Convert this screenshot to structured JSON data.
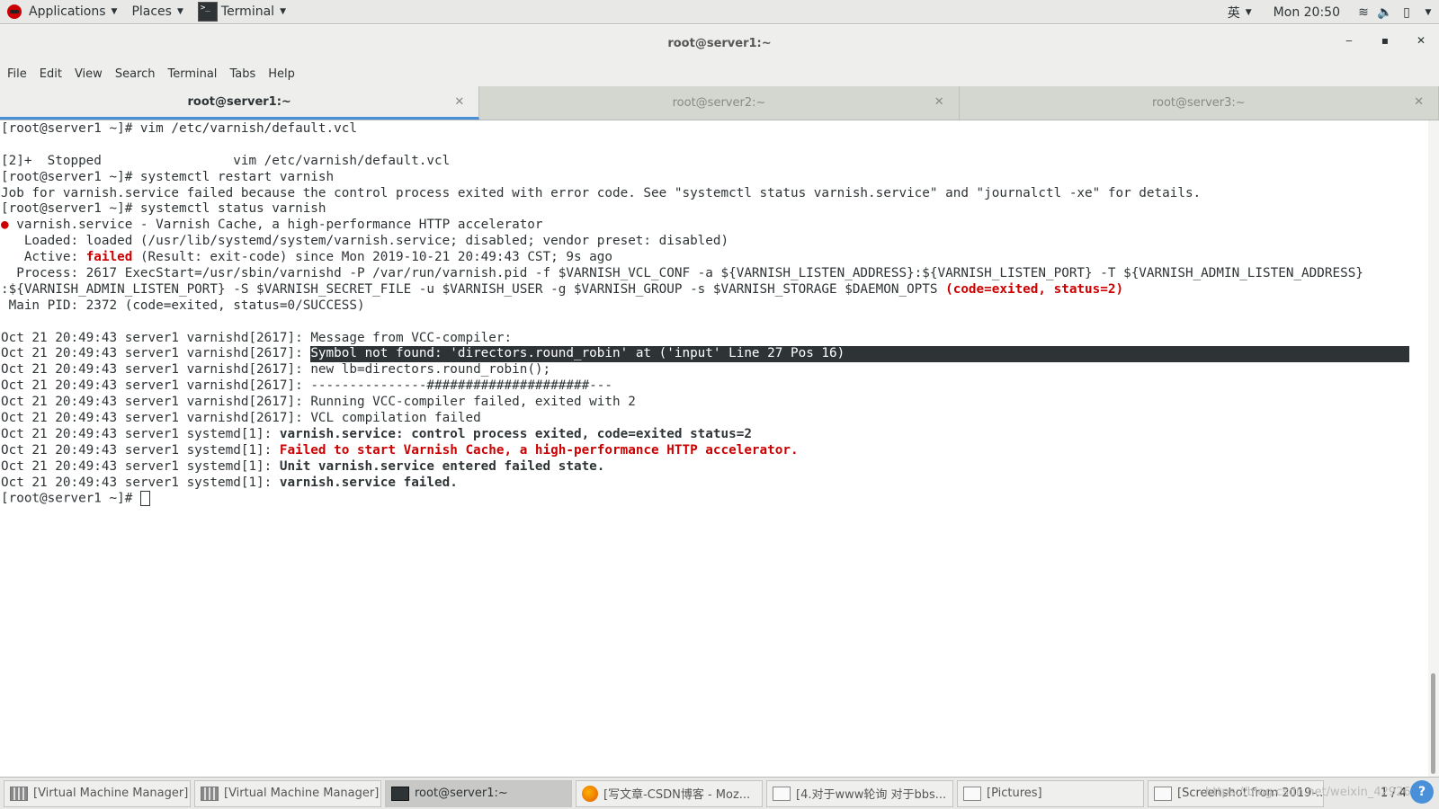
{
  "top_bar": {
    "applications_label": "Applications",
    "places_label": "Places",
    "terminal_label": "Terminal",
    "input_method": "英",
    "clock": "Mon 20:50"
  },
  "window": {
    "title": "root@server1:~",
    "minimize": "‒",
    "maximize": "▪",
    "close": "✕"
  },
  "menu": [
    "File",
    "Edit",
    "View",
    "Search",
    "Terminal",
    "Tabs",
    "Help"
  ],
  "tabs": [
    {
      "label": "root@server1:~",
      "active": true
    },
    {
      "label": "root@server2:~",
      "active": false
    },
    {
      "label": "root@server3:~",
      "active": false
    }
  ],
  "terminal": {
    "lines": [
      "[root@server1 ~]# vim /etc/varnish/default.vcl",
      "",
      "[2]+  Stopped                 vim /etc/varnish/default.vcl",
      "[root@server1 ~]# systemctl restart varnish",
      "Job for varnish.service failed because the control process exited with error code. See \"systemctl status varnish.service\" and \"journalctl -xe\" for details.",
      "[root@server1 ~]# systemctl status varnish"
    ],
    "status_dot": "●",
    "status_head": " varnish.service - Varnish Cache, a high-performance HTTP accelerator",
    "loaded_line": "   Loaded: loaded (/usr/lib/systemd/system/varnish.service; disabled; vendor preset: disabled)",
    "active_prefix": "   Active: ",
    "active_state": "failed",
    "active_rest": " (Result: exit-code) since Mon 2019-10-21 20:49:43 CST; 9s ago",
    "process_line1": "  Process: 2617 ExecStart=/usr/sbin/varnishd -P /var/run/varnish.pid -f $VARNISH_VCL_CONF -a ${VARNISH_LISTEN_ADDRESS}:${VARNISH_LISTEN_PORT} -T ${VARNISH_ADMIN_LISTEN_ADDRESS}",
    "process_line2": ":${VARNISH_ADMIN_LISTEN_PORT} -S $VARNISH_SECRET_FILE -u $VARNISH_USER -g $VARNISH_GROUP -s $VARNISH_STORAGE $DAEMON_OPTS ",
    "process_exit": "(code=exited, status=2)",
    "main_pid": " Main PID: 2372 (code=exited, status=0/SUCCESS)",
    "log_prefix_varnishd": "Oct 21 20:49:43 server1 varnishd[2617]: ",
    "log_prefix_systemd": "Oct 21 20:49:43 server1 systemd[1]: ",
    "log_msg1": "Message from VCC-compiler:",
    "log_msg2": "Symbol not found: 'directors.round_robin' at ('input' Line 27 Pos 16)",
    "log_msg3": "new lb=directors.round_robin();",
    "log_msg4": "---------------#####################---",
    "log_msg5": "Running VCC-compiler failed, exited with 2",
    "log_msg6": "VCL compilation failed",
    "log_msg7": "varnish.service: control process exited, code=exited status=2",
    "log_msg8": "Failed to start Varnish Cache, a high-performance HTTP accelerator.",
    "log_msg9": "Unit varnish.service entered failed state.",
    "log_msg10": "varnish.service failed.",
    "prompt": "[root@server1 ~]# "
  },
  "taskbar": {
    "items": [
      {
        "label": "[Virtual Machine Manager]",
        "icon": "vmm-icon"
      },
      {
        "label": "[Virtual Machine Manager]",
        "icon": "vmm-icon"
      },
      {
        "label": "root@server1:~",
        "icon": "terminal-icon",
        "active": true
      },
      {
        "label": "[写文章-CSDN博客 - Moz...",
        "icon": "firefox-icon"
      },
      {
        "label": "[4.对于www轮询 对于bbs...",
        "icon": "document-icon"
      },
      {
        "label": "[Pictures]",
        "icon": "folder-icon"
      },
      {
        "label": "[Screenshot from 2019-...",
        "icon": "image-viewer-icon"
      }
    ],
    "pager": "1 / 4",
    "watermark": "https://blog.csdn.net/weixin_42926590"
  }
}
